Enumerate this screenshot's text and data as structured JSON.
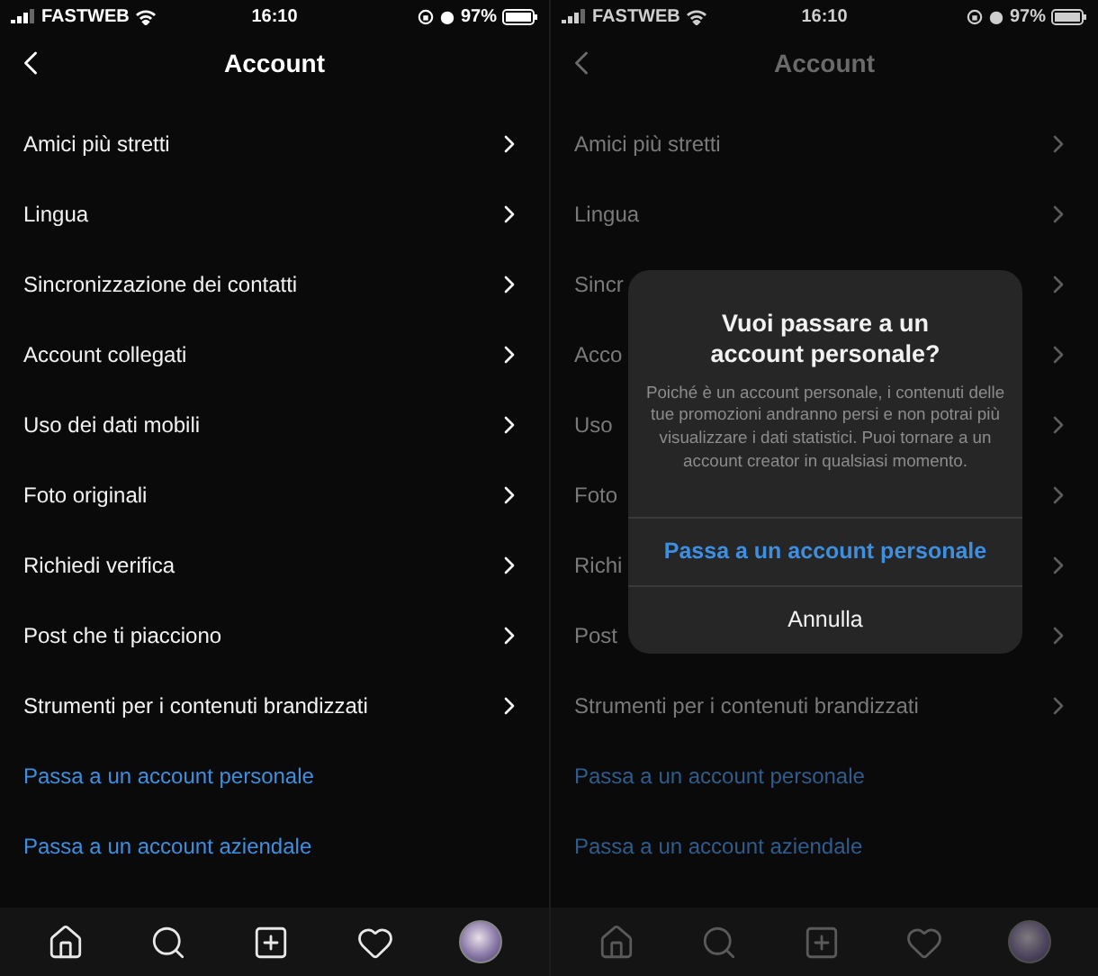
{
  "screens": [
    {
      "dimmed": false,
      "status_bar": {
        "carrier": "FASTWEB",
        "time": "16:10",
        "battery": "97%"
      },
      "title": "Account",
      "items": [
        {
          "kind": "nav",
          "label": "Amici più stretti"
        },
        {
          "kind": "nav",
          "label": "Lingua"
        },
        {
          "kind": "nav",
          "label": "Sincronizzazione dei contatti"
        },
        {
          "kind": "nav",
          "label": "Account collegati"
        },
        {
          "kind": "nav",
          "label": "Uso dei dati mobili"
        },
        {
          "kind": "nav",
          "label": "Foto originali"
        },
        {
          "kind": "nav",
          "label": "Richiedi verifica"
        },
        {
          "kind": "nav",
          "label": "Post che ti piacciono"
        },
        {
          "kind": "nav",
          "label": "Strumenti per i contenuti brandizzati"
        },
        {
          "kind": "link",
          "label": "Passa a un account personale"
        },
        {
          "kind": "link",
          "label": "Passa a un account aziendale"
        }
      ]
    },
    {
      "dimmed": true,
      "status_bar": {
        "carrier": "FASTWEB",
        "time": "16:10",
        "battery": "97%"
      },
      "title": "Account",
      "items": [
        {
          "kind": "nav",
          "label": "Amici più stretti"
        },
        {
          "kind": "nav",
          "label": "Lingua"
        },
        {
          "kind": "nav",
          "label": "Sincr"
        },
        {
          "kind": "nav",
          "label": "Acco"
        },
        {
          "kind": "nav",
          "label": "Uso"
        },
        {
          "kind": "nav",
          "label": "Foto"
        },
        {
          "kind": "nav",
          "label": "Richi"
        },
        {
          "kind": "nav",
          "label": "Post"
        },
        {
          "kind": "nav",
          "label": "Strumenti per i contenuti brandizzati"
        },
        {
          "kind": "link",
          "label": "Passa a un account personale"
        },
        {
          "kind": "link",
          "label": "Passa a un account aziendale"
        }
      ],
      "dialog": {
        "title": "Vuoi passare a un account personale?",
        "message": "Poiché è un account personale, i contenuti delle tue promozioni andranno persi e non potrai più visualizzare i dati statistici. Puoi tornare a un account creator in qualsiasi momento.",
        "confirm": "Passa a un account personale",
        "cancel": "Annulla"
      }
    }
  ]
}
